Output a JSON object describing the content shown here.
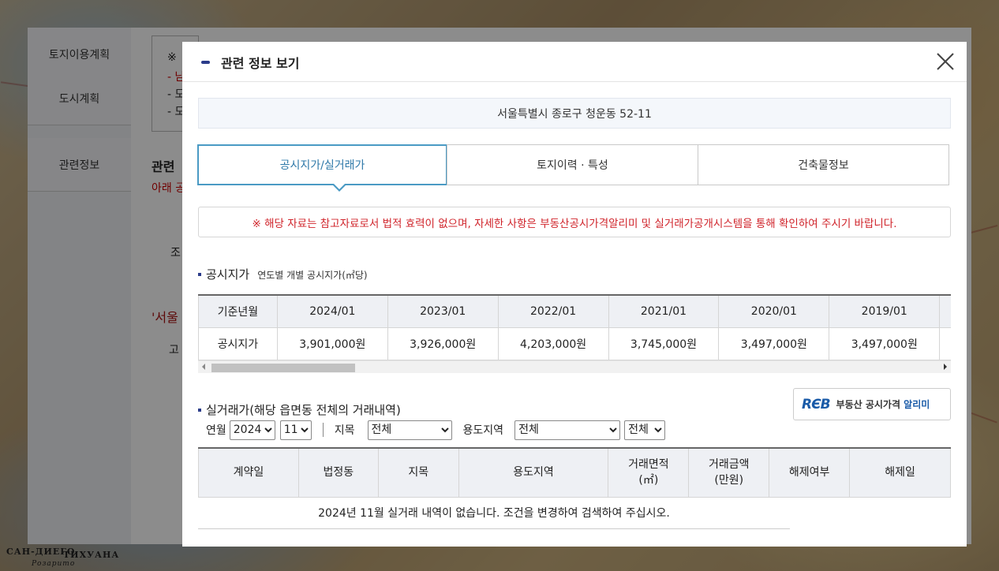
{
  "background": {
    "sidebar": [
      "토지이용계획",
      "도시계획",
      "관련정보"
    ],
    "fragments": {
      "note_mark": "※",
      "dash1": "- 남",
      "dash2": "- 모",
      "dash3": "- 모",
      "related": "관련",
      "below": "아래 공",
      "cho": "조",
      "seoul": "'서울",
      "go": "고"
    },
    "map_labels": [
      "САН-ДИЕГО",
      "ТИХУАНА",
      "Розарито"
    ]
  },
  "modal": {
    "title": "관련 정보 보기",
    "address": "서울특별시 종로구 청운동 52-11",
    "tabs": [
      {
        "label": "공시지가/실거래가",
        "active": true
      },
      {
        "label": "토지이력 · 특성",
        "active": false
      },
      {
        "label": "건축물정보",
        "active": false
      }
    ],
    "notice": "※ 해당 자료는 참고자료로서 법적 효력이 없으며, 자세한 사항은 부동산공시가격알리미 및 실거래가공개시스템을 통해 확인하여 주시기 바랍니다.",
    "land_price": {
      "title": "공시지가",
      "subtitle": "연도별 개별 공시지가(㎡당)",
      "row_header_period": "기준년월",
      "row_header_price": "공시지가",
      "periods": [
        "2024/01",
        "2023/01",
        "2022/01",
        "2021/01",
        "2020/01",
        "2019/01"
      ],
      "prices": [
        "3,901,000원",
        "3,926,000원",
        "4,203,000원",
        "3,745,000원",
        "3,497,000원",
        "3,497,000원"
      ]
    },
    "reb": {
      "mark": "RЄB",
      "text_prefix": "부동산 공시가격 ",
      "text_highlight": "알리미"
    },
    "transactions": {
      "title": "실거래가(해당 읍면동 전체의 거래내역)",
      "period_label": "연월",
      "year": "2024",
      "month": "11",
      "land_type_label": "지목",
      "land_type": "전체",
      "zone_label": "용도지역",
      "zone": "전체",
      "zone2": "전체",
      "columns": [
        "계약일",
        "법정동",
        "지목",
        "용도지역",
        "거래면적\n(㎡)",
        "거래금액\n(만원)",
        "해제여부",
        "해제일"
      ],
      "empty_message": "2024년 11월 실거래 내역이 없습니다. 조건을 변경하여 검색하여 주십시오."
    }
  },
  "colors": {
    "accent": "#4a9ac4",
    "notice_red": "#d0242b",
    "brand_navy": "#2b3c8a"
  }
}
